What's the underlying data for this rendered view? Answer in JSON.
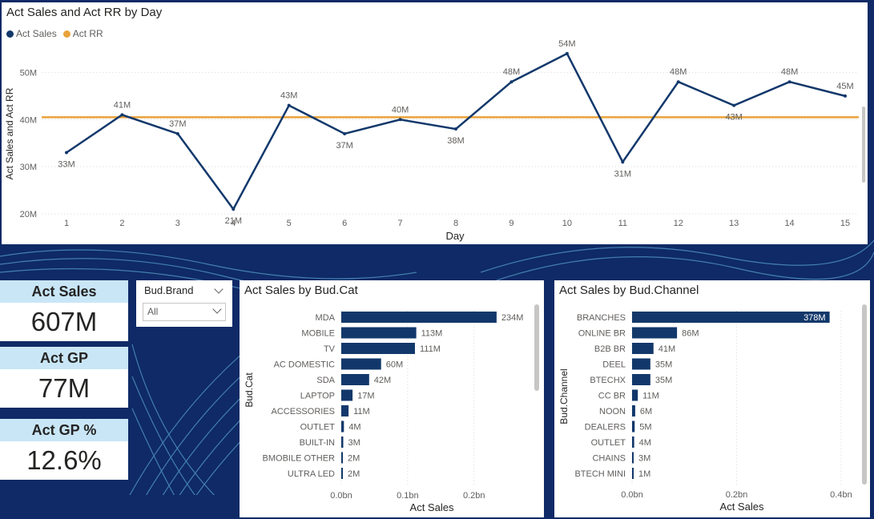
{
  "line_chart": {
    "title": "Act Sales and Act RR by Day",
    "legend": [
      {
        "label": "Act Sales",
        "color": "#12386b"
      },
      {
        "label": "Act RR",
        "color": "#e8a33a"
      }
    ],
    "chart_data": {
      "type": "line",
      "x": [
        1,
        2,
        3,
        4,
        5,
        6,
        7,
        8,
        9,
        10,
        11,
        12,
        13,
        14,
        15
      ],
      "series": [
        {
          "name": "Act Sales",
          "values": [
            33,
            41,
            37,
            21,
            43,
            37,
            40,
            38,
            48,
            54,
            31,
            48,
            43,
            48,
            45
          ],
          "labels": [
            "33M",
            "41M",
            "37M",
            "21M",
            "43M",
            "37M",
            "40M",
            "38M",
            "48M",
            "54M",
            "31M",
            "48M",
            "43M",
            "48M",
            "45M"
          ]
        },
        {
          "name": "Act RR",
          "values": [
            40.5,
            40.5,
            40.5,
            40.5,
            40.5,
            40.5,
            40.5,
            40.5,
            40.5,
            40.5,
            40.5,
            40.5,
            40.5,
            40.5,
            40.5
          ]
        }
      ],
      "y_ticks": [
        20,
        30,
        40,
        50
      ],
      "y_tick_labels": [
        "20M",
        "30M",
        "40M",
        "50M"
      ],
      "ylim": [
        20,
        55
      ],
      "xlabel": "Day",
      "ylabel": "Act Sales and Act RR",
      "grid": true
    }
  },
  "kpis": [
    {
      "label": "Act Sales",
      "value": "607M"
    },
    {
      "label": "Act GP",
      "value": "77M"
    },
    {
      "label": "Act GP %",
      "value": "12.6%"
    }
  ],
  "slicer": {
    "title": "Bud.Brand",
    "value": "All"
  },
  "cat_chart": {
    "title": "Act Sales by Bud.Cat",
    "chart_data": {
      "type": "bar",
      "orientation": "horizontal",
      "categories": [
        "MDA",
        "MOBILE",
        "TV",
        "AC DOMESTIC",
        "SDA",
        "LAPTOP",
        "ACCESSORIES",
        "OUTLET",
        "BUILT-IN",
        "BMOBILE OTHER",
        "ULTRA LED"
      ],
      "values": [
        234,
        113,
        111,
        60,
        42,
        17,
        11,
        4,
        3,
        2,
        2
      ],
      "labels": [
        "234M",
        "113M",
        "111M",
        "60M",
        "42M",
        "17M",
        "11M",
        "4M",
        "3M",
        "2M",
        "2M"
      ],
      "x_ticks": [
        0,
        100,
        200
      ],
      "x_tick_labels": [
        "0.0bn",
        "0.1bn",
        "0.2bn"
      ],
      "xlim": [
        0,
        245
      ],
      "xlabel": "Act Sales",
      "ylabel": "Bud.Cat"
    }
  },
  "channel_chart": {
    "title": "Act Sales by Bud.Channel",
    "chart_data": {
      "type": "bar",
      "orientation": "horizontal",
      "categories": [
        "BRANCHES",
        "ONLINE BR",
        "B2B BR",
        "DEEL",
        "BTECHX",
        "CC BR",
        "NOON",
        "DEALERS",
        "OUTLET",
        "CHAINS",
        "BTECH MINI"
      ],
      "values": [
        378,
        86,
        41,
        35,
        35,
        11,
        6,
        5,
        4,
        3,
        1
      ],
      "labels": [
        "378M",
        "86M",
        "41M",
        "35M",
        "35M",
        "11M",
        "6M",
        "5M",
        "4M",
        "3M",
        "1M"
      ],
      "x_ticks": [
        0,
        200,
        400
      ],
      "x_tick_labels": [
        "0.0bn",
        "0.2bn",
        "0.4bn"
      ],
      "xlim": [
        0,
        420
      ],
      "xlabel": "Act Sales",
      "ylabel": "Bud.Channel"
    }
  },
  "colors": {
    "bar": "#12386b",
    "line": "#12386b",
    "rr_line": "#e8a33a",
    "kpi_header": "#c9e6f7",
    "background": "#0f2a66"
  }
}
